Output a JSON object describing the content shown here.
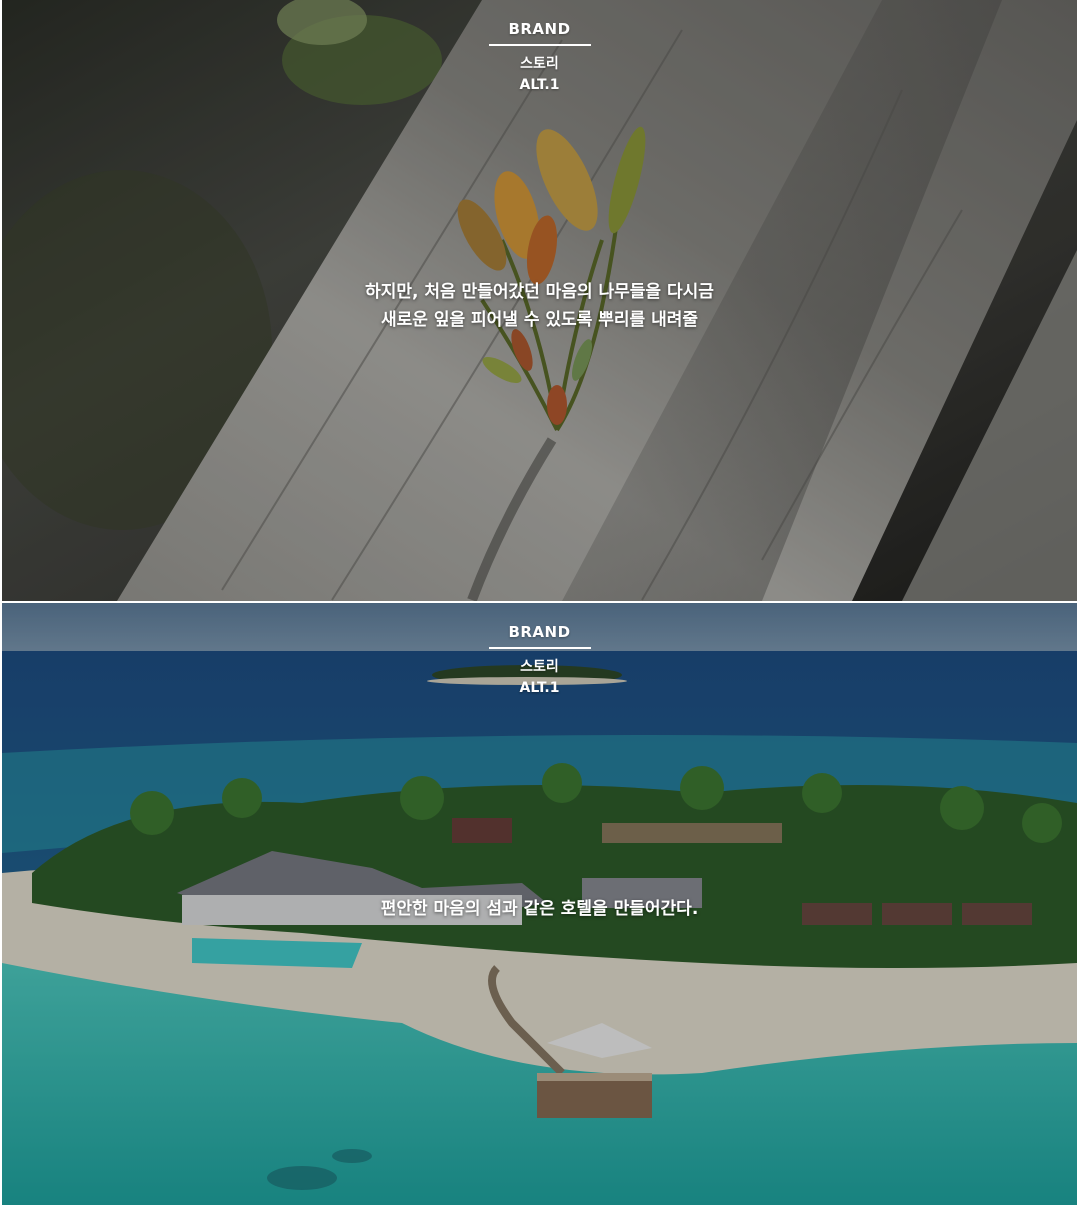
{
  "sections": [
    {
      "brand_label": "BRAND",
      "story_label": "스토리",
      "alt_label": "ALT.1",
      "headline_line1": "하지만, 처음 만들어갔던 마음의 나무들을 다시금",
      "headline_line2": "새로운 잎을 피어낼 수 있도록 뿌리를 내려줄",
      "image_description": "Close-up of a green sprout growing from a grey weathered tree trunk"
    },
    {
      "brand_label": "BRAND",
      "story_label": "스토리",
      "alt_label": "ALT.1",
      "headline_line1": "편안한 마음의 섬과 같은 호텔을 만들어간다.",
      "image_description": "Aerial view of a tropical island resort with turquoise lagoon, pool and pier"
    }
  ],
  "colors": {
    "overlay": "#000000",
    "text": "#ffffff",
    "lagoon": "#2fb8b0",
    "ocean": "#1f4f86",
    "trunk": "#8a8a86"
  }
}
